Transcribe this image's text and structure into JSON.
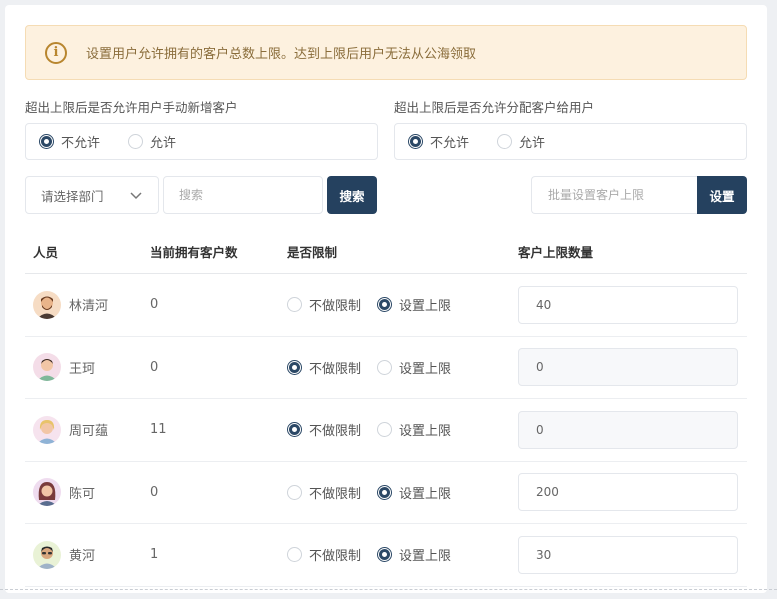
{
  "notice": {
    "icon": "info-icon",
    "text": "设置用户允许拥有的客户总数上限。达到上限后用户无法从公海领取"
  },
  "settings": [
    {
      "label": "超出上限后是否允许用户手动新增客户",
      "options": [
        "不允许",
        "允许"
      ],
      "selected": 0
    },
    {
      "label": "超出上限后是否允许分配客户给用户",
      "options": [
        "不允许",
        "允许"
      ],
      "selected": 0
    }
  ],
  "toolbar": {
    "department_placeholder": "请选择部门",
    "search_placeholder": "搜索",
    "search_label": "搜索",
    "batch_placeholder": "批量设置客户上限",
    "set_label": "设置"
  },
  "table": {
    "headers": [
      "人员",
      "当前拥有客户数",
      "是否限制",
      "客户上限数量"
    ],
    "limit_options": [
      "不做限制",
      "设置上限"
    ],
    "rows": [
      {
        "name": "林清河",
        "count": "0",
        "limit": 1,
        "qty": "40"
      },
      {
        "name": "王珂",
        "count": "0",
        "limit": 0,
        "qty": "0"
      },
      {
        "name": "周可蕴",
        "count": "11",
        "limit": 0,
        "qty": "0"
      },
      {
        "name": "陈可",
        "count": "0",
        "limit": 1,
        "qty": "200"
      },
      {
        "name": "黄河",
        "count": "1",
        "limit": 1,
        "qty": "30"
      }
    ]
  },
  "colors": {
    "accent": "#25415f",
    "notice_bg": "#fdf1df",
    "notice_text": "#8a6d3b"
  }
}
